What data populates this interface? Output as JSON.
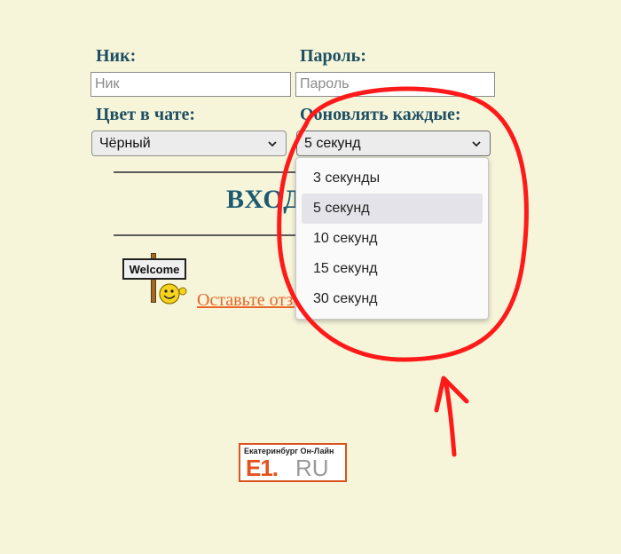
{
  "top_fragment": {
    "text": "",
    "link": ""
  },
  "form": {
    "nick_label": "Ник:",
    "nick_placeholder": "Ник",
    "password_label": "Пароль:",
    "password_placeholder": "Пароль",
    "color_label": "Цвет в чате:",
    "color_selected": "Чёрный",
    "refresh_label": "Обновлять каждые:",
    "refresh_selected": "5 секунд",
    "refresh_options": [
      "3 секунды",
      "5 секунд",
      "10 секунд",
      "15 секунд",
      "30 секунд"
    ]
  },
  "login_title": "ВХОД",
  "welcome": {
    "sign_text": "Welcome",
    "link_text": "Оставьте отзыв"
  },
  "banner": {
    "tagline": "Екатеринбург Он-Лайн",
    "brand": "E1.",
    "suffix": "RU"
  },
  "colors": {
    "background": "#f6f5da",
    "heading": "#1d4e62",
    "link": "#e8662a",
    "annotation": "#ff1a1a"
  }
}
